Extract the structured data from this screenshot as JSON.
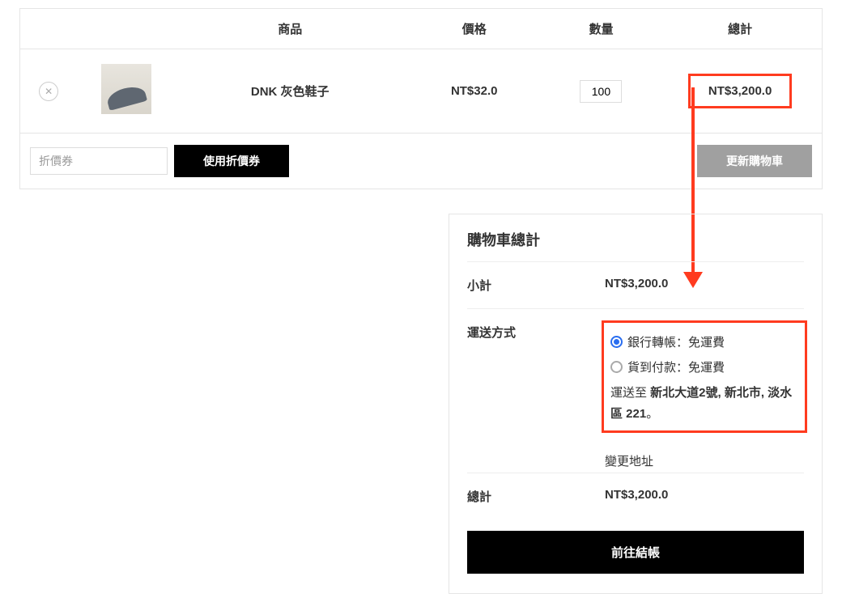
{
  "headers": {
    "product": "商品",
    "price": "價格",
    "qty": "數量",
    "total": "總計"
  },
  "item": {
    "name": "DNK 灰色鞋子",
    "price": "NT$32.0",
    "qty": "100",
    "total": "NT$3,200.0"
  },
  "coupon": {
    "placeholder": "折價券",
    "apply": "使用折價券",
    "update": "更新購物車"
  },
  "summary": {
    "title": "購物車總計",
    "subtotal_label": "小計",
    "subtotal_value": "NT$3,200.0",
    "shipping_label": "運送方式",
    "ship_opt1": "銀行轉帳：免運費",
    "ship_opt2": "貨到付款：免運費",
    "ship_to_prefix": "運送至 ",
    "ship_to_addr": "新北大道2號, 新北市, 淡水區 221",
    "ship_to_suffix": "。",
    "change_addr": "變更地址",
    "total_label": "總計",
    "total_value": "NT$3,200.0",
    "checkout": "前往結帳"
  }
}
